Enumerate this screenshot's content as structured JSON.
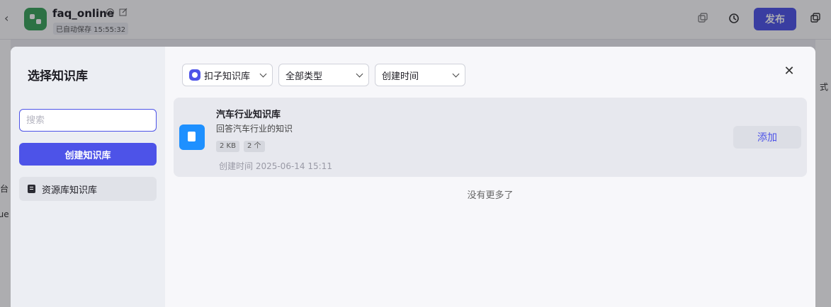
{
  "app": {
    "title": "faq_online",
    "save_status": "已自动保存 15:55:32",
    "publish_label": "发布"
  },
  "background": {
    "left_fragments": [
      "台",
      "que"
    ],
    "right_fragment": "式"
  },
  "modal": {
    "title": "选择知识库",
    "search_placeholder": "搜索",
    "create_label": "创建知识库",
    "resource_item_label": "资源库知识库",
    "filters": {
      "source": "扣子知识库",
      "type": "全部类型",
      "sort": "创建时间"
    },
    "close_glyph": "✕",
    "items": [
      {
        "title": "汽车行业知识库",
        "description": "回答汽车行业的知识",
        "size": "2 KB",
        "count": "2 个",
        "created": "创建时间 2025-06-14 15:11",
        "add_label": "添加"
      }
    ],
    "no_more": "没有更多了"
  },
  "colors": {
    "accent": "#4d53e8",
    "doc_icon": "#1e90ff",
    "app_logo": "#3aa35a"
  }
}
